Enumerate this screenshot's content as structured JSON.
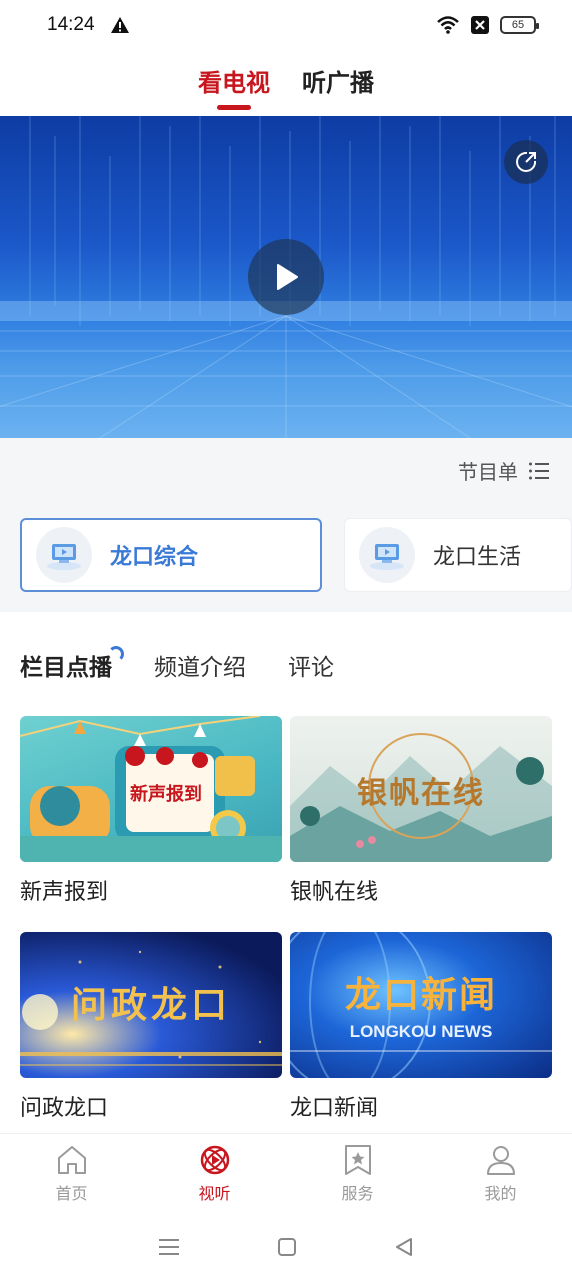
{
  "status_bar": {
    "time": "14:24",
    "battery": "65",
    "icons": [
      "warning-icon",
      "wifi-icon",
      "sim-blocked-icon",
      "battery-icon"
    ]
  },
  "top_tabs": [
    {
      "label": "看电视",
      "active": true
    },
    {
      "label": "听广播",
      "active": false
    }
  ],
  "video": {
    "play_icon": "play-icon",
    "share_icon": "share-icon"
  },
  "schedule": {
    "label": "节目单",
    "icon": "list-icon"
  },
  "channels": [
    {
      "name": "龙口综合",
      "selected": true,
      "icon": "tv-channel-icon"
    },
    {
      "name": "龙口生活",
      "selected": false,
      "icon": "tv-channel-icon"
    }
  ],
  "sub_tabs": [
    {
      "label": "栏目点播",
      "active": true
    },
    {
      "label": "频道介绍",
      "active": false
    },
    {
      "label": "评论",
      "active": false
    }
  ],
  "programs": [
    {
      "title": "新声报到",
      "thumb_text": "新声报到"
    },
    {
      "title": "银帆在线",
      "thumb_text": "银帆在线"
    },
    {
      "title": "问政龙口",
      "thumb_text": "问政龙口"
    },
    {
      "title": "龙口新闻",
      "thumb_text": "龙口新闻",
      "thumb_subtext": "LONGKOU NEWS"
    }
  ],
  "bottom_nav": [
    {
      "label": "首页",
      "icon": "home-icon",
      "active": false
    },
    {
      "label": "视听",
      "icon": "media-icon",
      "active": true
    },
    {
      "label": "服务",
      "icon": "service-icon",
      "active": false
    },
    {
      "label": "我的",
      "icon": "profile-icon",
      "active": false
    }
  ],
  "colors": {
    "accent": "#c8161e",
    "channel_selected": "#3a7ad6",
    "nav_inactive": "#9a9a9a"
  }
}
